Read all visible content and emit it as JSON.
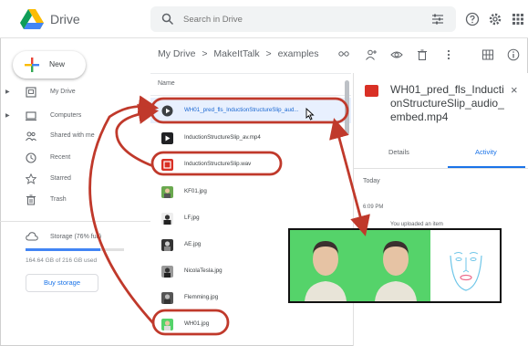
{
  "app": {
    "name": "Drive"
  },
  "search": {
    "placeholder": "Search in Drive"
  },
  "sidebar": {
    "new_label": "New",
    "items": [
      {
        "label": "My Drive",
        "icon": "my-drive-icon",
        "has_caret": true
      },
      {
        "label": "Computers",
        "icon": "computer-icon",
        "has_caret": true
      },
      {
        "label": "Shared with me",
        "icon": "shared-icon",
        "has_caret": false
      },
      {
        "label": "Recent",
        "icon": "clock-icon",
        "has_caret": false
      },
      {
        "label": "Starred",
        "icon": "star-icon",
        "has_caret": false
      },
      {
        "label": "Trash",
        "icon": "trash-icon",
        "has_caret": false
      }
    ],
    "storage": {
      "label": "Storage (76% full)",
      "used_text": "164.64 GB of 216 GB used",
      "fraction": 0.76,
      "buy_label": "Buy storage"
    }
  },
  "breadcrumb": {
    "items": [
      "My Drive",
      "MakeItTalk",
      "examples"
    ],
    "separator": ">"
  },
  "list": {
    "column_name": "Name",
    "files": [
      {
        "name": "WH01_pred_fls_InductionStructureSlip_aud...",
        "type": "video",
        "selected": true
      },
      {
        "name": "InductionStructureSlip_av.mp4",
        "type": "video-dark"
      },
      {
        "name": "InductionStructureSlip.wav",
        "type": "audio"
      },
      {
        "name": "KF01.jpg",
        "type": "image"
      },
      {
        "name": "LF.jpg",
        "type": "image"
      },
      {
        "name": "AE.jpg",
        "type": "image"
      },
      {
        "name": "NicolaTesla.jpg",
        "type": "image"
      },
      {
        "name": "Flemming.jpg",
        "type": "image"
      },
      {
        "name": "WH01.jpg",
        "type": "image"
      }
    ]
  },
  "panel": {
    "title": "WH01_pred_fls_InductionStructureSlip_audio_embed.mp4",
    "tabs": [
      "Details",
      "Activity"
    ],
    "active_tab": "Activity",
    "today": "Today",
    "time": "6:09 PM",
    "activity": "You uploaded an item"
  },
  "colors": {
    "annotation": "#c0392b",
    "accent": "#1a73e8",
    "selected_bg": "#e8f0fe",
    "video_bg": "#55d36a"
  }
}
